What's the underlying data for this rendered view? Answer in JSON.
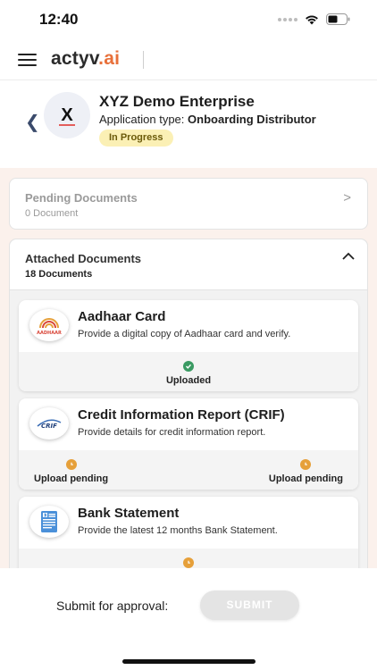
{
  "status_bar": {
    "time": "12:40"
  },
  "header": {
    "brand_main": "actyv",
    "brand_dot": ".",
    "brand_suffix": "ai"
  },
  "enterprise": {
    "initial": "X",
    "name": "XYZ Demo Enterprise",
    "type_label": "Application type:",
    "type_value": "Onboarding Distributor",
    "status": "In Progress"
  },
  "pending": {
    "title": "Pending Documents",
    "count": "0 Document"
  },
  "attached": {
    "title": "Attached Documents",
    "count": "18 Documents",
    "documents": [
      {
        "title": "Aadhaar Card",
        "description": "Provide a digital copy of Aadhaar card and verify.",
        "statuses": [
          "Uploaded"
        ]
      },
      {
        "title": "Credit Information Report (CRIF)",
        "description": "Provide details for credit information report.",
        "statuses": [
          "Upload pending",
          "Upload pending"
        ]
      },
      {
        "title": "Bank Statement",
        "description": "Provide the latest 12 months Bank Statement.",
        "statuses": [
          ""
        ]
      }
    ]
  },
  "logos": {
    "aadhaar": "AADHAAR",
    "crif": "CRIF"
  },
  "submit": {
    "label": "Submit for approval:",
    "button": "SUBMIT"
  },
  "colors": {
    "accent": "#e8703a",
    "content_bg": "#fbf1ec",
    "uploaded": "#3a9a62",
    "pending": "#e6a03a",
    "badge_bg": "#fbf0b5"
  },
  "icons": [
    "menu-icon",
    "wifi-icon",
    "battery-icon",
    "chevron-left-icon",
    "chevron-right-icon",
    "chevron-up-icon",
    "check-circle-icon",
    "clock-icon"
  ]
}
